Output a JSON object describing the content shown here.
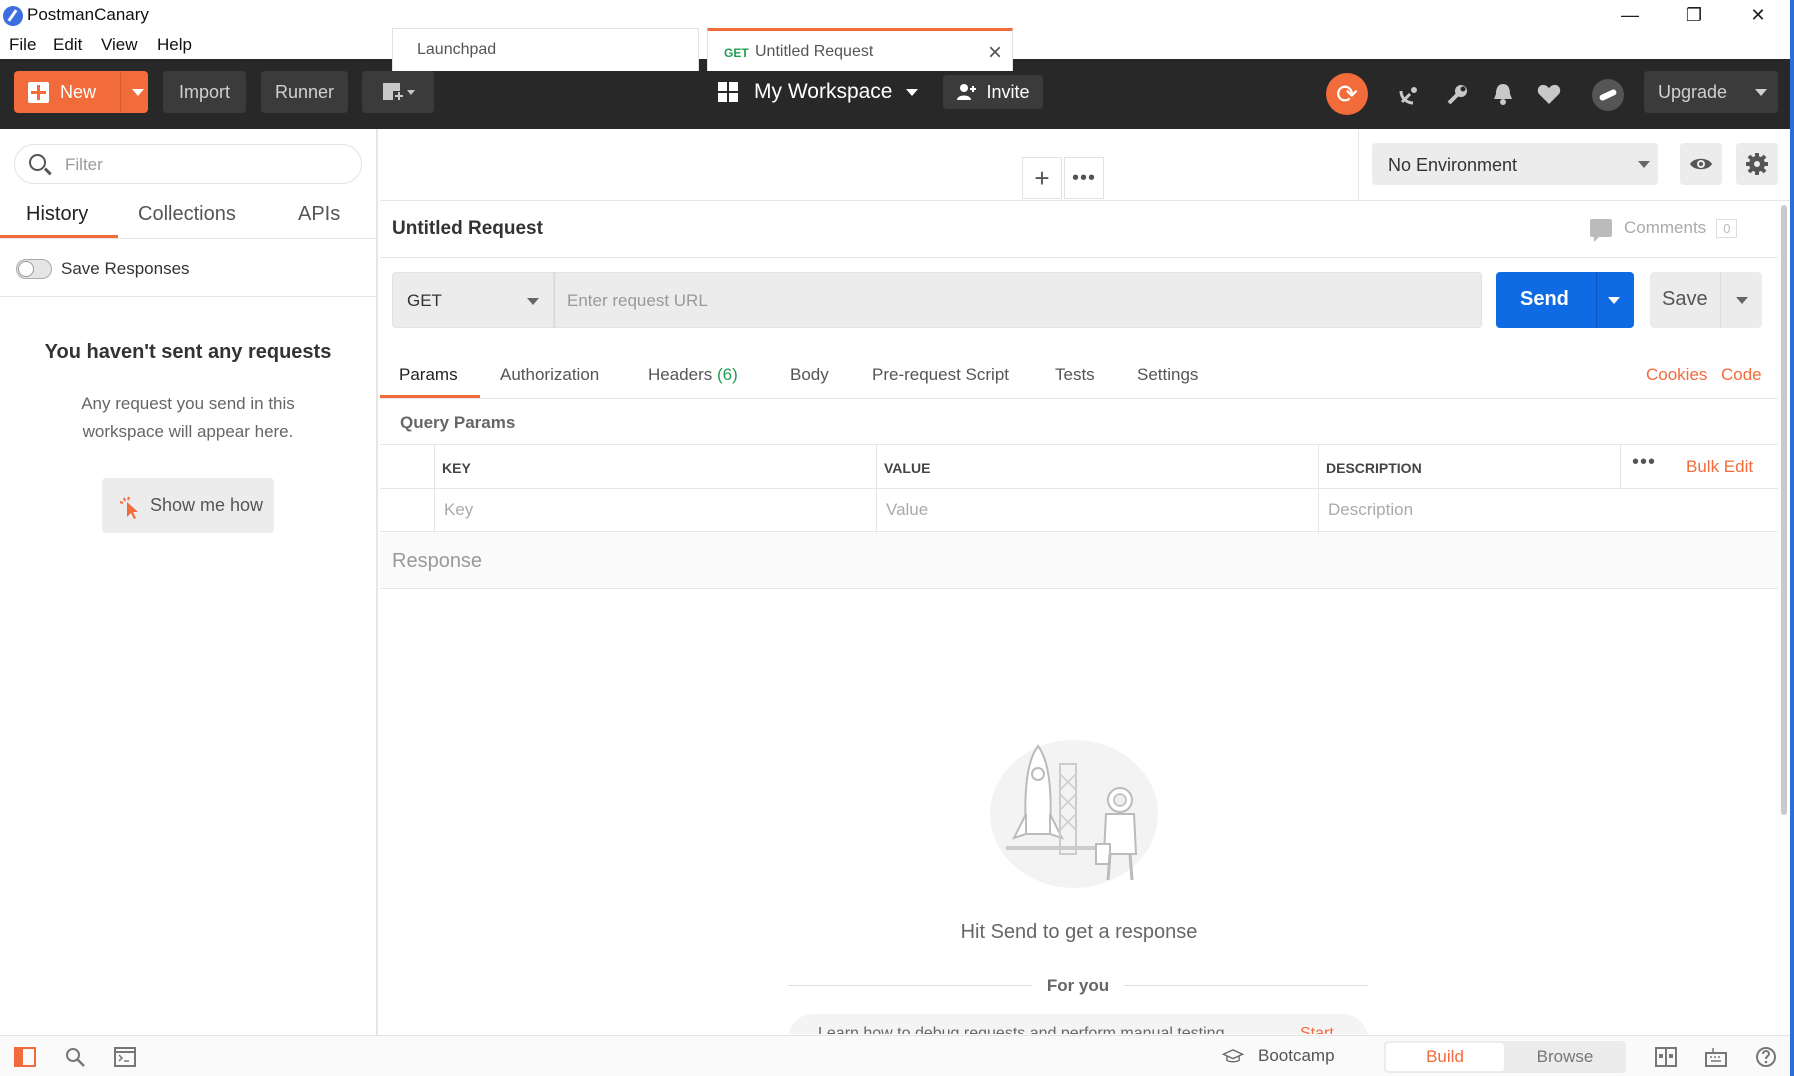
{
  "window": {
    "title": "PostmanCanary",
    "minimize": "—",
    "restore": "❐",
    "close": "✕"
  },
  "menu": [
    "File",
    "Edit",
    "View",
    "Help"
  ],
  "toolbar": {
    "new_label": "New",
    "import_label": "Import",
    "runner_label": "Runner",
    "workspace_label": "My Workspace",
    "invite_label": "Invite",
    "upgrade_label": "Upgrade"
  },
  "sidebar": {
    "filter_placeholder": "Filter",
    "tabs": [
      "History",
      "Collections",
      "APIs"
    ],
    "save_responses_label": "Save Responses",
    "empty_title": "You haven't sent any requests",
    "empty_desc": "Any request you send in this workspace will appear here.",
    "show_me_label": "Show me how"
  },
  "tabs": {
    "launchpad": "Launchpad",
    "active_method": "GET",
    "active_label": "Untitled Request"
  },
  "environment": {
    "selected": "No Environment"
  },
  "request": {
    "name": "Untitled Request",
    "comments_label": "Comments",
    "comments_count": "0",
    "method": "GET",
    "url_placeholder": "Enter request URL",
    "send_label": "Send",
    "save_label": "Save"
  },
  "request_tabs": {
    "params": "Params",
    "authorization": "Authorization",
    "headers": "Headers",
    "headers_count": "(6)",
    "body": "Body",
    "prerequest": "Pre-request Script",
    "tests": "Tests",
    "settings": "Settings",
    "cookies": "Cookies",
    "code": "Code"
  },
  "query_params": {
    "title": "Query Params",
    "headers": [
      "KEY",
      "VALUE",
      "DESCRIPTION"
    ],
    "placeholders": [
      "Key",
      "Value",
      "Description"
    ],
    "bulk_edit": "Bulk Edit"
  },
  "response": {
    "label": "Response",
    "hint": "Hit Send to get a response",
    "for_you": "For you",
    "promo_text": "Learn how to debug requests and perform manual testing",
    "promo_start": "Start"
  },
  "statusbar": {
    "bootcamp": "Bootcamp",
    "build": "Build",
    "browse": "Browse"
  },
  "colors": {
    "accent": "#f26b3a",
    "send_blue": "#0f6be4",
    "header_bg": "#282828",
    "method_get": "#1f9f50"
  }
}
